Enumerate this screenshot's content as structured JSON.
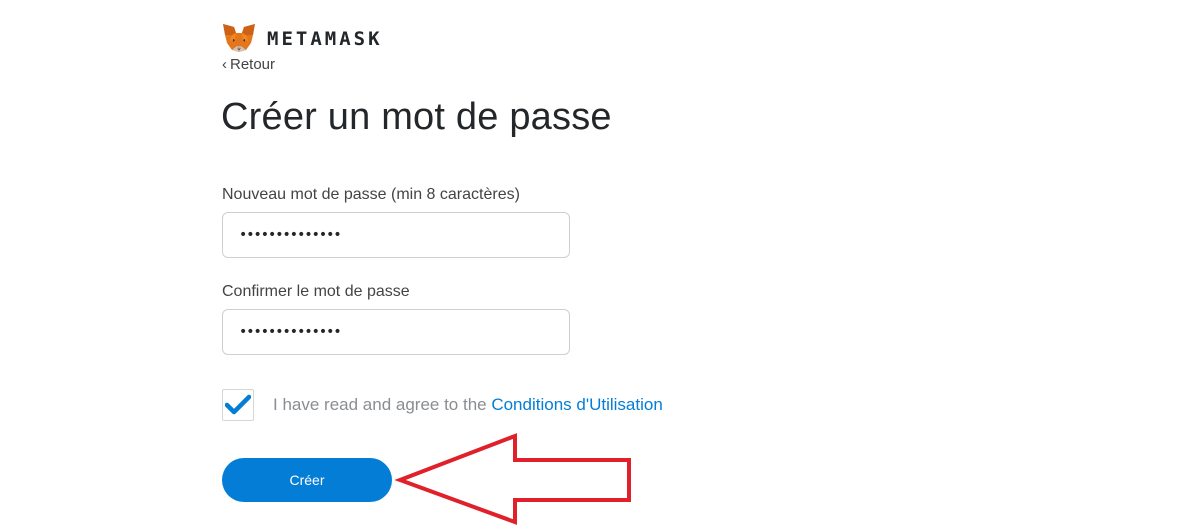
{
  "brand": {
    "name": "METAMASK",
    "logo_icon": "metamask-fox-icon"
  },
  "nav": {
    "back_label": "Retour",
    "back_icon": "chevron-left-icon"
  },
  "page": {
    "title": "Créer un mot de passe"
  },
  "form": {
    "new_password": {
      "label": "Nouveau mot de passe (min 8 caractères)",
      "value": "••••••••••••••"
    },
    "confirm_password": {
      "label": "Confirmer le mot de passe",
      "value": "••••••••••••••"
    },
    "agree": {
      "checked": true,
      "text": "I have read and agree to the ",
      "link_text": "Conditions d'Utilisation"
    },
    "submit_label": "Créer"
  },
  "annotation": {
    "arrow_icon": "red-arrow-left-icon",
    "color": "#e0202a"
  },
  "colors": {
    "accent": "#037dd6",
    "text": "#24272a",
    "muted": "#8a8d91"
  }
}
